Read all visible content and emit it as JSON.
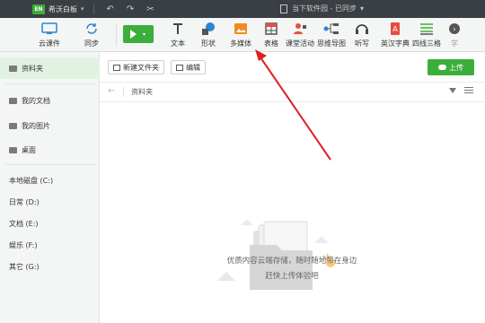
{
  "titlebar": {
    "logo_text": "EN",
    "app_name": "希沃白板",
    "caret": "▾",
    "doc_title": "当下软件园 - 已同步",
    "doc_caret": "▾"
  },
  "toolbar": {
    "cloud_label": "云课件",
    "sync_label": "同步",
    "items": [
      {
        "label": "文本"
      },
      {
        "label": "形状"
      },
      {
        "label": "多媒体"
      },
      {
        "label": "表格"
      },
      {
        "label": "课堂活动"
      },
      {
        "label": "思维导图"
      },
      {
        "label": "听写"
      },
      {
        "label": "英汉字典"
      },
      {
        "label": "四线三格"
      },
      {
        "label": "学"
      }
    ]
  },
  "sidebar": {
    "items": [
      {
        "label": "资料夹"
      },
      {
        "label": "我的文档"
      },
      {
        "label": "我的图片"
      },
      {
        "label": "桌面"
      },
      {
        "label": "本地磁盘 (C:)"
      },
      {
        "label": "日常 (D:)"
      },
      {
        "label": "文档 (E:)"
      },
      {
        "label": "娱乐 (F:)"
      },
      {
        "label": "其它 (G:)"
      }
    ]
  },
  "actions": {
    "new_folder": "新建文件夹",
    "edit": "编辑",
    "upload": "上传"
  },
  "nav": {
    "breadcrumb": "资料夹"
  },
  "empty": {
    "line1": "优质内容云端存储，随时随地带在身边",
    "line2": "赶快上传体验吧"
  },
  "colors": {
    "accent": "#3cae3a",
    "annotation_arrow": "#e02020"
  }
}
